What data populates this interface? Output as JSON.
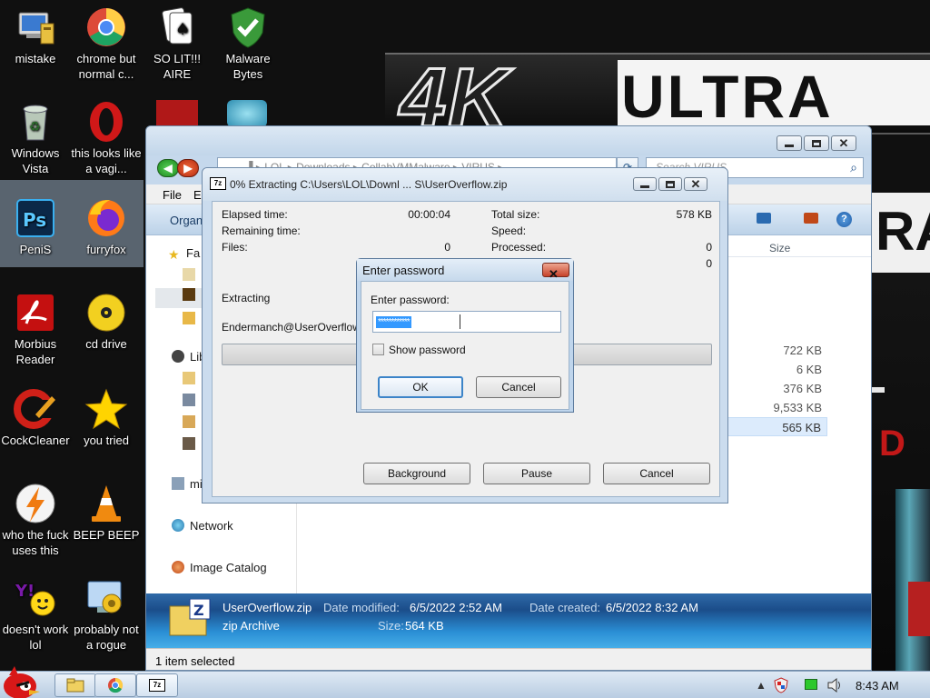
{
  "desktop": {
    "icons": [
      {
        "label": "mistake"
      },
      {
        "label": "chrome but normal c..."
      },
      {
        "label": "SO LIT!!! AIRE"
      },
      {
        "label": "Malware Bytes"
      },
      {
        "label": "Windows Vista"
      },
      {
        "label": "this looks like a vagi..."
      },
      {
        "label": "PeniS"
      },
      {
        "label": "furryfox"
      },
      {
        "label": "Morbius Reader"
      },
      {
        "label": "cd drive"
      },
      {
        "label": "CockCleaner"
      },
      {
        "label": "you tried"
      },
      {
        "label": "who the fuck uses this"
      },
      {
        "label": "BEEP BEEP"
      },
      {
        "label": "doesn't work lol"
      },
      {
        "label": "probably not a rogue"
      }
    ],
    "wallpaper": {
      "text_4k": "4K",
      "text_ultra": "ULTRA",
      "text_ray": "RAY",
      "text_d": "D"
    }
  },
  "explorer": {
    "address": "▐ ▸ LOL ▸ Downloads ▸ CollabVMMalware ▸ VIRUS ▸",
    "search_placeholder": "Search VIRUS",
    "menu": {
      "file": "File",
      "edit": "Ed"
    },
    "organize": "Organ",
    "nav": {
      "favorites": "Fa",
      "libraries": "Lib",
      "homegroup": "mi",
      "network": "Network",
      "image_catalog": "Image Catalog"
    },
    "columns": {
      "size": "Size"
    },
    "sizes": [
      "722 KB",
      "6 KB",
      "376 KB",
      "9,533 KB",
      "565 KB"
    ],
    "details": {
      "filename": "UserOverflow.zip",
      "type": "zip Archive",
      "modified_label": "Date modified:",
      "modified": "6/5/2022 2:52 AM",
      "created_label": "Date created:",
      "created": "6/5/2022 8:32 AM",
      "size_label": "Size:",
      "size": "564 KB"
    },
    "status": "1 item selected"
  },
  "extract": {
    "title": "0% Extracting C:\\Users\\LOL\\Downl ... S\\UserOverflow.zip",
    "elapsed_label": "Elapsed time:",
    "elapsed": "00:00:04",
    "remaining_label": "Remaining time:",
    "files_label": "Files:",
    "files": "0",
    "total_label": "Total size:",
    "total": "578 KB",
    "speed_label": "Speed:",
    "processed_label": "Processed:",
    "processed": "0",
    "ratio": "0",
    "extracting_label": "Extracting",
    "current_file": "Endermanch@UserOverflow.exe",
    "progress_percent": 0,
    "buttons": {
      "background": "Background",
      "pause": "Pause",
      "cancel": "Cancel"
    }
  },
  "password": {
    "title": "Enter password",
    "prompt": "Enter password:",
    "value": "************",
    "show_label": "Show password",
    "ok": "OK",
    "cancel": "Cancel"
  },
  "taskbar": {
    "time": "8:43 AM",
    "zip_label": "7z"
  },
  "colors": {
    "accent": "#3399ff",
    "selection": "#dcebfc"
  }
}
